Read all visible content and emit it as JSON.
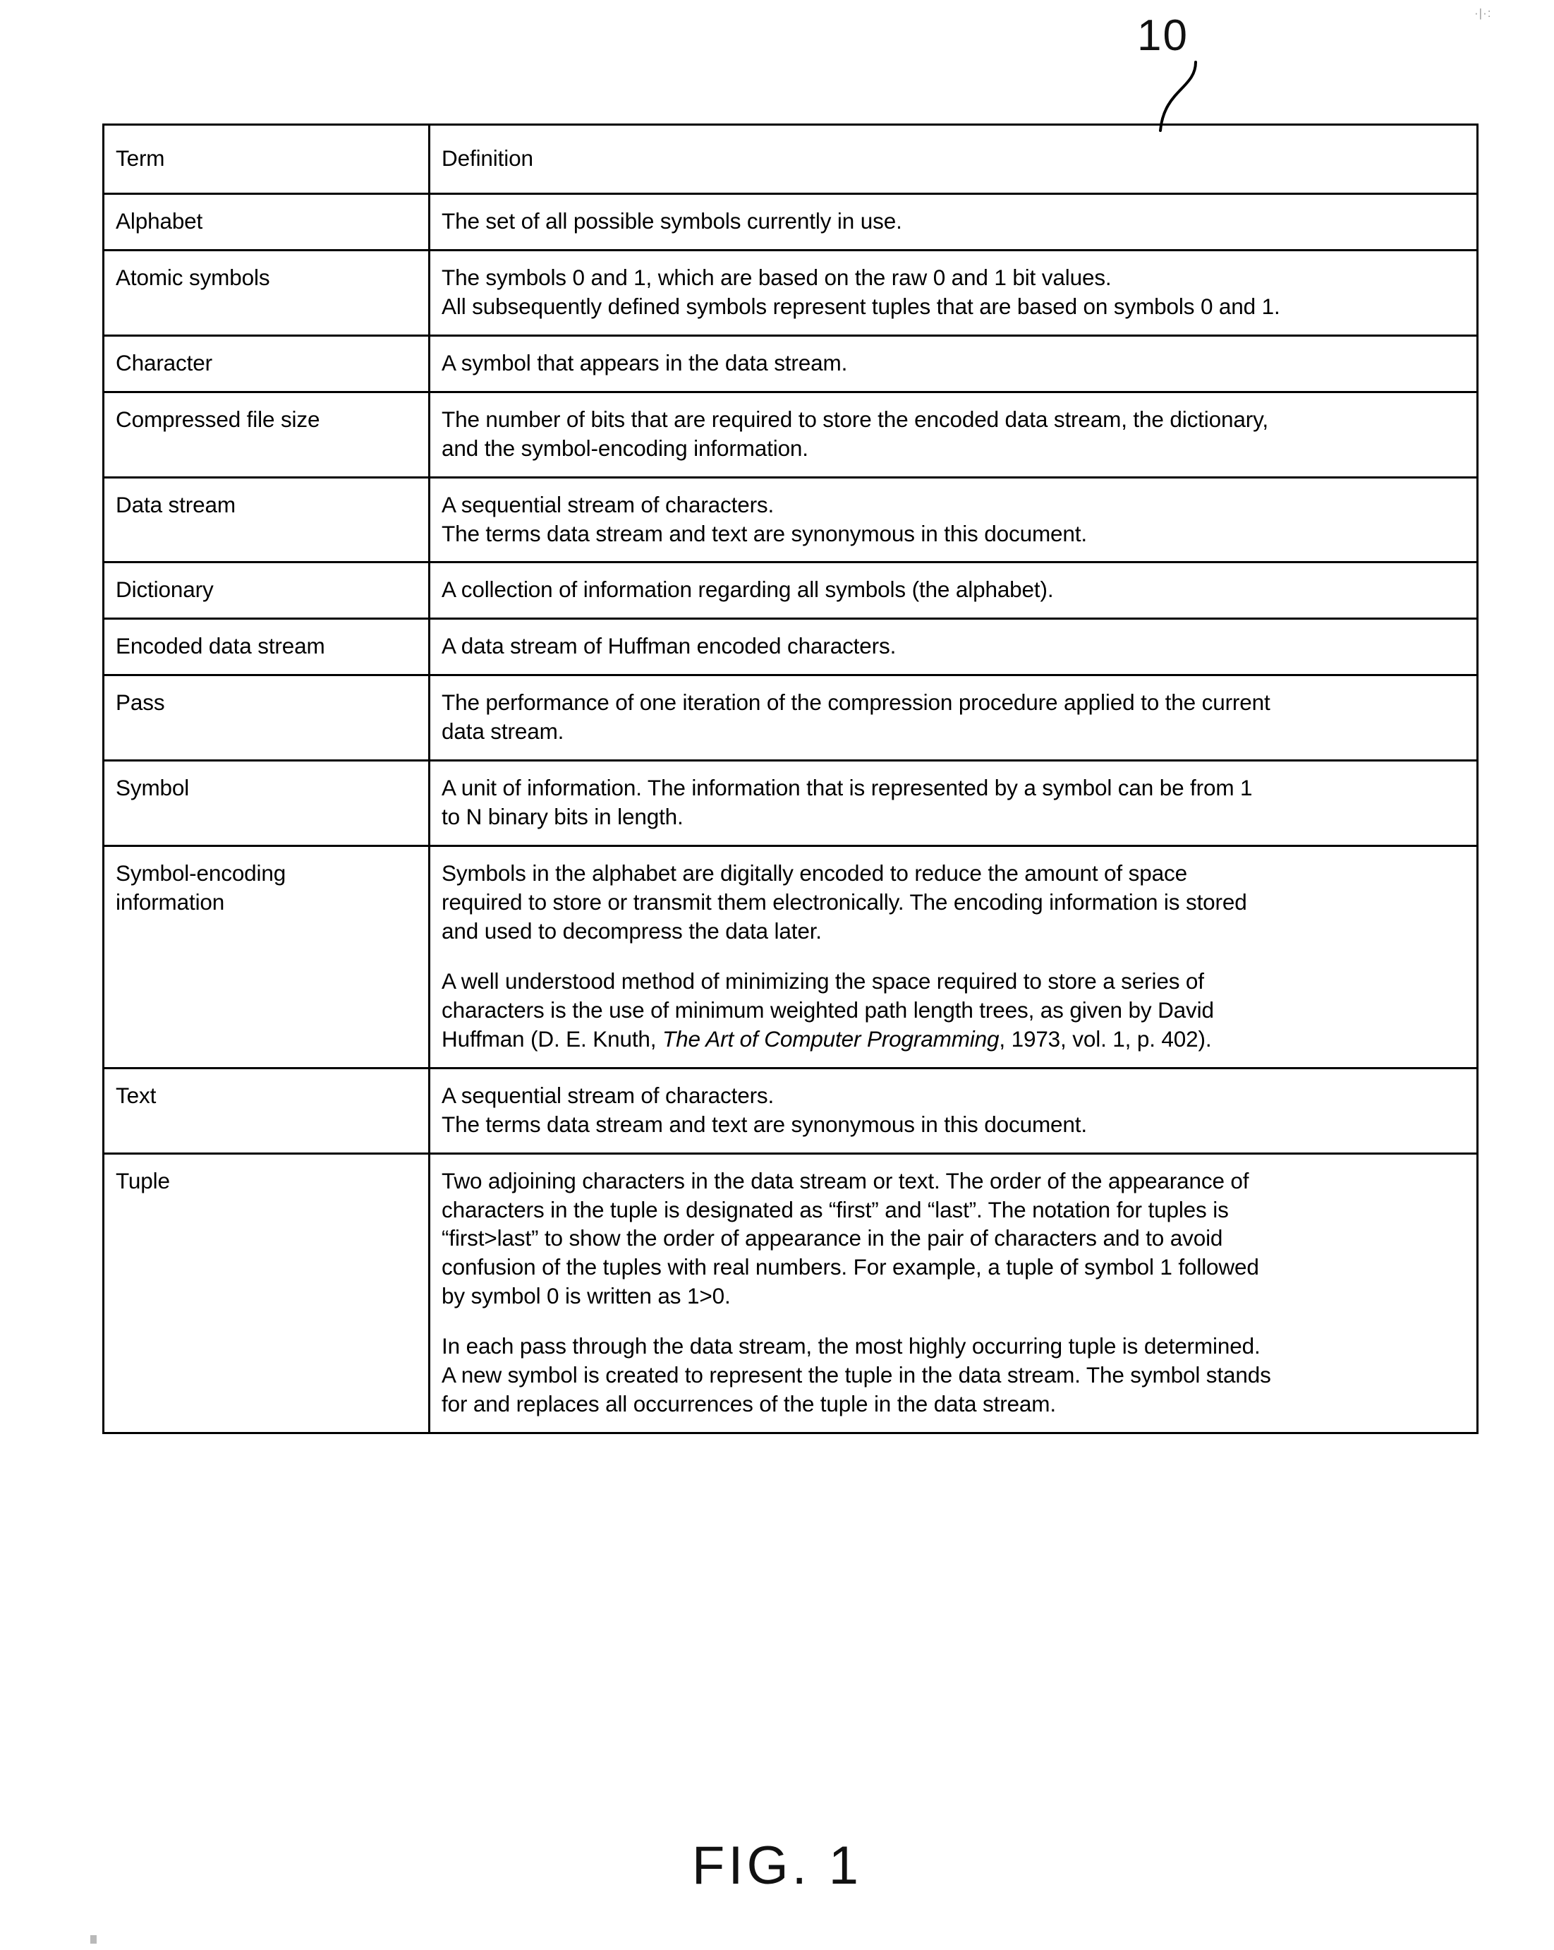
{
  "figure": {
    "reference_numeral": "10",
    "caption": "FIG. 1",
    "scan_artifact_top": "·|·:",
    "ink_color": "#000000"
  },
  "table": {
    "headers": {
      "term": "Term",
      "definition": "Definition"
    },
    "rows": [
      {
        "term": "Alphabet",
        "definition_paragraphs": [
          [
            "The set of all possible symbols currently in use."
          ]
        ]
      },
      {
        "term": "Atomic symbols",
        "definition_paragraphs": [
          [
            "The symbols 0 and 1, which are based on the raw 0 and 1 bit values.",
            "All subsequently defined symbols represent tuples that are based on symbols 0 and 1."
          ]
        ]
      },
      {
        "term": "Character",
        "definition_paragraphs": [
          [
            "A symbol that appears in the data stream."
          ]
        ]
      },
      {
        "term": "Compressed file size",
        "definition_paragraphs": [
          [
            "The number of bits that are required to store the encoded data stream, the dictionary,",
            "and the symbol-encoding information."
          ]
        ]
      },
      {
        "term": "Data stream",
        "definition_paragraphs": [
          [
            "A sequential stream of characters.",
            "The terms data stream and text are synonymous in this document."
          ]
        ]
      },
      {
        "term": "Dictionary",
        "definition_paragraphs": [
          [
            "A collection of information regarding all symbols (the alphabet)."
          ]
        ]
      },
      {
        "term": "Encoded data stream",
        "definition_paragraphs": [
          [
            "A data stream of Huffman encoded characters."
          ]
        ]
      },
      {
        "term": "Pass",
        "definition_paragraphs": [
          [
            "The performance of one iteration of the compression procedure applied to the current",
            "data stream."
          ]
        ]
      },
      {
        "term": "Symbol",
        "definition_paragraphs": [
          [
            "A unit of information. The information that is represented by a symbol can be from 1",
            "to N binary bits in length."
          ]
        ]
      },
      {
        "term": "Symbol-encoding\ninformation",
        "definition_paragraphs": [
          [
            "Symbols in the alphabet are digitally encoded to reduce the amount of space",
            "required to store or transmit them electronically. The encoding information is stored",
            "and used to decompress the data later."
          ],
          [
            "A well understood method of minimizing the space required to store a series of",
            "characters is the use of minimum weighted path length trees, as given by David",
            "Huffman (D. E. Knuth, <i>The Art of Computer Programming</i>, 1973, vol. 1, p. 402)."
          ]
        ]
      },
      {
        "term": "Text",
        "definition_paragraphs": [
          [
            "A sequential stream of characters.",
            "The terms data stream and text are synonymous in this document."
          ]
        ]
      },
      {
        "term": "Tuple",
        "definition_paragraphs": [
          [
            "Two adjoining characters in the data stream or text. The order of the appearance of",
            "characters in the tuple is designated as &ldquo;first&rdquo; and &ldquo;last&rdquo;. The notation for tuples is",
            "&ldquo;first&gt;last&rdquo; to show the order of appearance in the pair of characters and to avoid",
            "confusion of the tuples with real numbers. For example, a tuple of symbol 1 followed",
            "by symbol 0 is written as 1&gt;0."
          ],
          [
            "In each pass through the data stream, the most highly occurring tuple is determined.",
            "A new symbol is created to represent the tuple in the data stream. The symbol stands",
            "for and replaces all occurrences of the tuple in the data stream."
          ]
        ]
      }
    ]
  }
}
